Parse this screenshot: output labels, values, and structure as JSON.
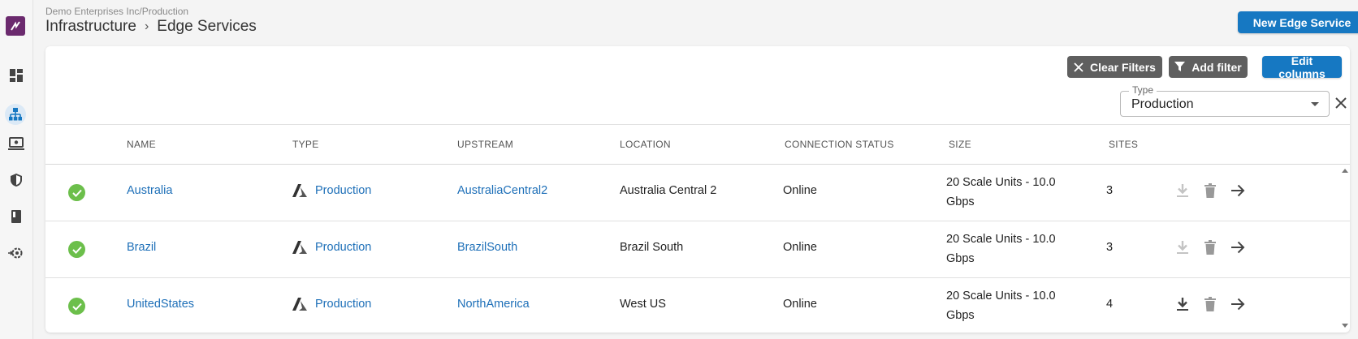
{
  "header": {
    "org_path": "Demo Enterprises Inc/Production",
    "breadcrumb_root": "Infrastructure",
    "breadcrumb_separator": "›",
    "breadcrumb_current": "Edge Services",
    "new_button": "New Edge Service"
  },
  "toolbar": {
    "clear_filters": "Clear Filters",
    "add_filter": "Add filter",
    "edit_columns": "Edit columns"
  },
  "filter": {
    "label": "Type",
    "value": "Production"
  },
  "table": {
    "columns": [
      "NAME",
      "TYPE",
      "UPSTREAM",
      "LOCATION",
      "CONNECTION STATUS",
      "SIZE",
      "SITES"
    ],
    "rows": [
      {
        "name": "Australia",
        "type": "Production",
        "upstream": "AustraliaCentral2",
        "location": "Australia Central 2",
        "status": "Online",
        "size": "20 Scale Units - 10.0 Gbps",
        "sites": "3",
        "download_enabled": false
      },
      {
        "name": "Brazil",
        "type": "Production",
        "upstream": "BrazilSouth",
        "location": "Brazil South",
        "status": "Online",
        "size": "20 Scale Units - 10.0 Gbps",
        "sites": "3",
        "download_enabled": false
      },
      {
        "name": "UnitedStates",
        "type": "Production",
        "upstream": "NorthAmerica",
        "location": "West US",
        "status": "Online",
        "size": "20 Scale Units - 10.0 Gbps",
        "sites": "4",
        "download_enabled": true
      }
    ]
  },
  "colors": {
    "primary": "#1678c2",
    "secondary_button": "#5f5f5f",
    "online": "#6cbf4b",
    "link": "#1d6fb8",
    "brand": "#6b2a6e"
  },
  "icons": {
    "rail": [
      "dashboard-icon",
      "network-icon",
      "device-icon",
      "shield-icon",
      "book-icon",
      "settings-icon"
    ]
  }
}
